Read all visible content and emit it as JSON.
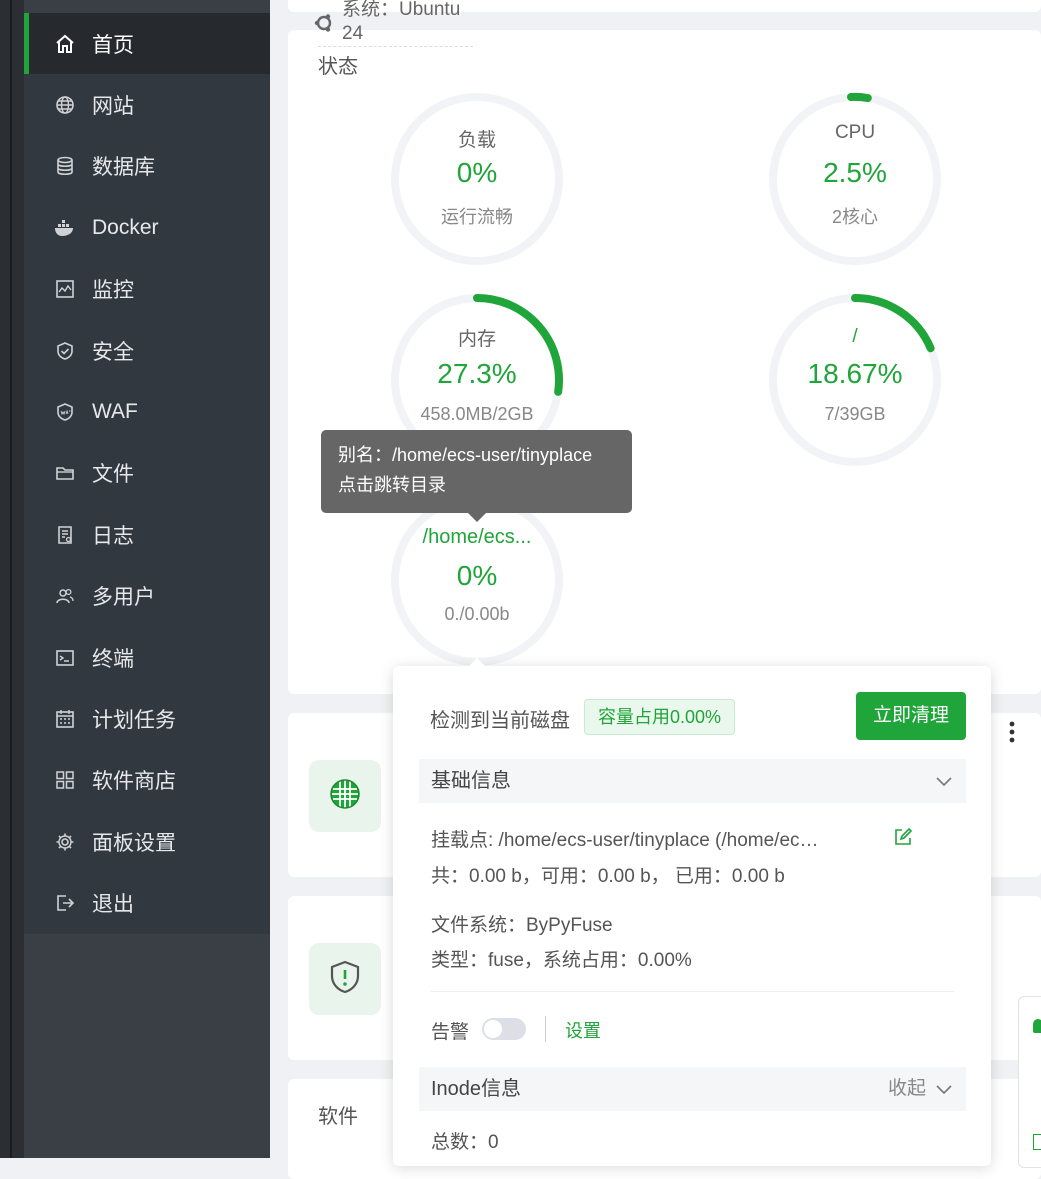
{
  "sidebar": {
    "items": [
      {
        "label": "首页",
        "icon": "home-icon"
      },
      {
        "label": "网站",
        "icon": "globe-icon"
      },
      {
        "label": "数据库",
        "icon": "database-icon"
      },
      {
        "label": "Docker",
        "icon": "docker-icon"
      },
      {
        "label": "监控",
        "icon": "monitor-icon"
      },
      {
        "label": "安全",
        "icon": "shield-icon"
      },
      {
        "label": "WAF",
        "icon": "waf-shield-icon"
      },
      {
        "label": "文件",
        "icon": "folder-icon"
      },
      {
        "label": "日志",
        "icon": "log-icon"
      },
      {
        "label": "多用户",
        "icon": "users-icon"
      },
      {
        "label": "终端",
        "icon": "terminal-icon"
      },
      {
        "label": "计划任务",
        "icon": "calendar-icon"
      },
      {
        "label": "软件商店",
        "icon": "grid-icon"
      },
      {
        "label": "面板设置",
        "icon": "gear-icon"
      },
      {
        "label": "退出",
        "icon": "logout-icon"
      }
    ]
  },
  "system": {
    "label": "系统：Ubuntu",
    "version": "24"
  },
  "status": {
    "title": "状态",
    "gauges": [
      {
        "label": "负载",
        "value": "0%",
        "sub": "运行流畅",
        "fraction": 0
      },
      {
        "label": "CPU",
        "value": "2.5%",
        "sub": "2核心",
        "fraction": 0.025
      },
      {
        "label": "内存",
        "value": "27.3%",
        "sub": "458.0MB/2GB",
        "fraction": 0.273
      },
      {
        "label": "/",
        "value": "18.67%",
        "sub": "7/39GB",
        "fraction": 0.1867
      },
      {
        "label": "/home/ecs...",
        "value": "0%",
        "sub": "0./0.00b",
        "fraction": 0
      }
    ]
  },
  "tooltip": {
    "line1": "别名：/home/ecs-user/tinyplace",
    "line2": "点击跳转目录"
  },
  "disk_popover": {
    "title": "检测到当前磁盘",
    "badge": "容量占用0.00%",
    "clean_button": "立即清理",
    "basic_section": "基础信息",
    "mount": "挂载点:  /home/ecs-user/tinyplace (/home/ec…",
    "totals": "共：0.00 b，可用：0.00 b， 已用：0.00 b",
    "filesystem": "文件系统：ByPyFuse",
    "type": "类型：fuse，系统占用：0.00%",
    "alarm_label": "告警",
    "settings_link": "设置",
    "inode_section": "Inode信息",
    "collapse": "收起",
    "inode_total": "总数：0"
  },
  "software_title": "软件",
  "colors": {
    "accent": "#20a53a",
    "sidebar": "#323840",
    "sidebar_active": "#262a2f"
  }
}
